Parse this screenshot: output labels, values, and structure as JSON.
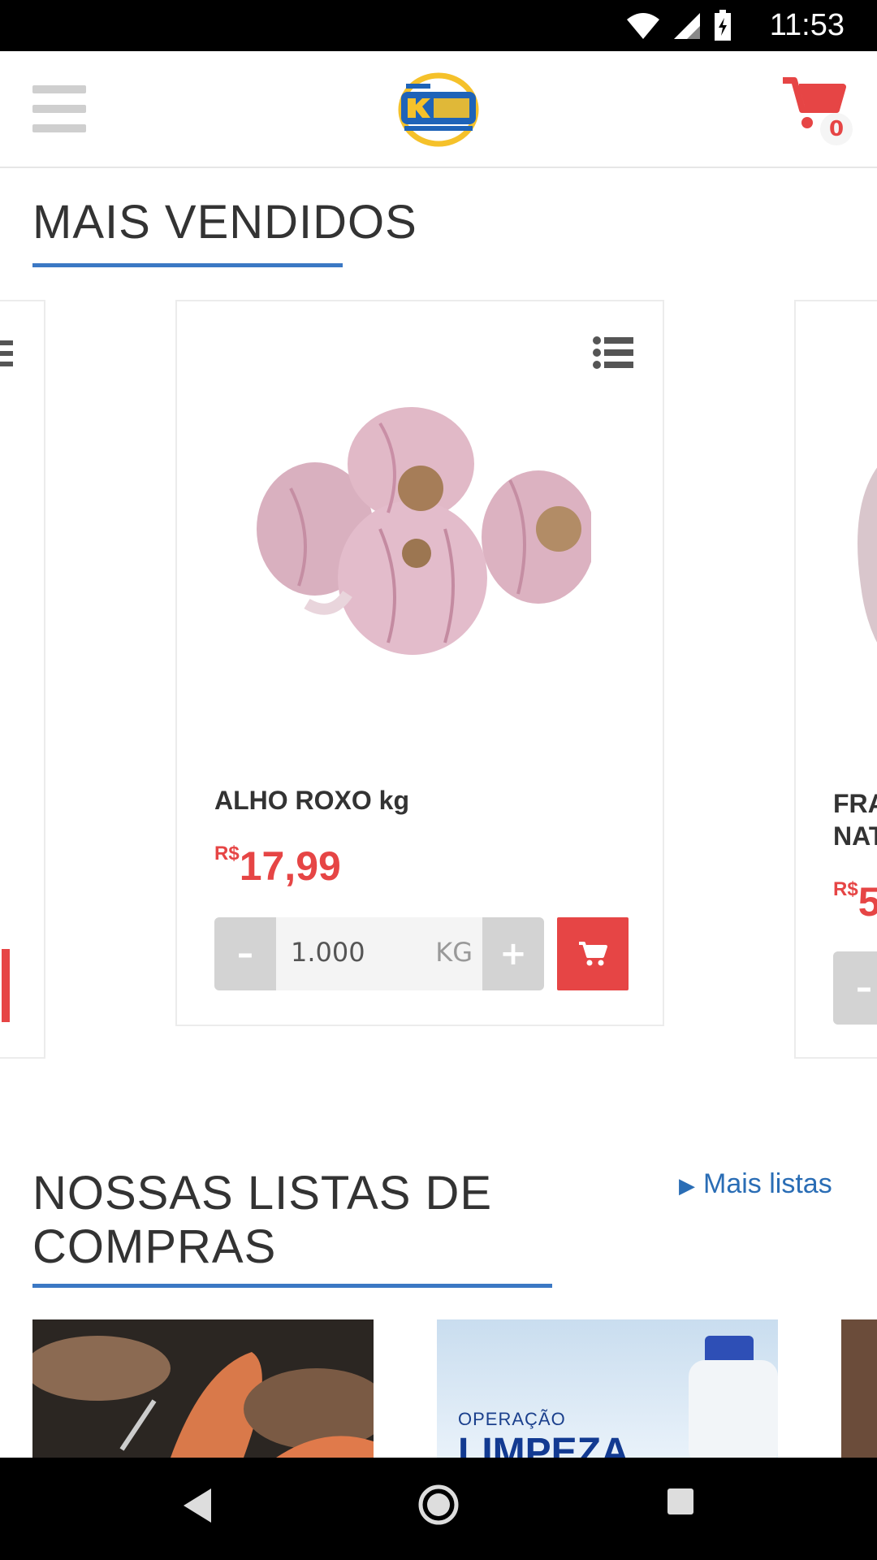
{
  "status_bar": {
    "time": "11:53"
  },
  "header": {
    "cart_count": "0"
  },
  "best_sellers": {
    "title": "MAIS VENDIDOS",
    "product": {
      "name": "ALHO ROXO kg",
      "currency": "R$",
      "price": "17,99",
      "quantity": "1.000",
      "unit": "KG",
      "minus_label": "–",
      "plus_label": "+"
    },
    "next_product": {
      "name_partial": "FRA NAT",
      "currency": "R$",
      "price_partial": "5",
      "minus_label": "–"
    }
  },
  "shopping_lists": {
    "title": "NOSSAS LISTAS DE COMPRAS",
    "more_link": "Mais listas",
    "thumb2": {
      "small": "OPERAÇÃO",
      "big": "LIMPEZA"
    }
  },
  "colors": {
    "accent_red": "#e64545",
    "accent_blue": "#3b78c4"
  }
}
